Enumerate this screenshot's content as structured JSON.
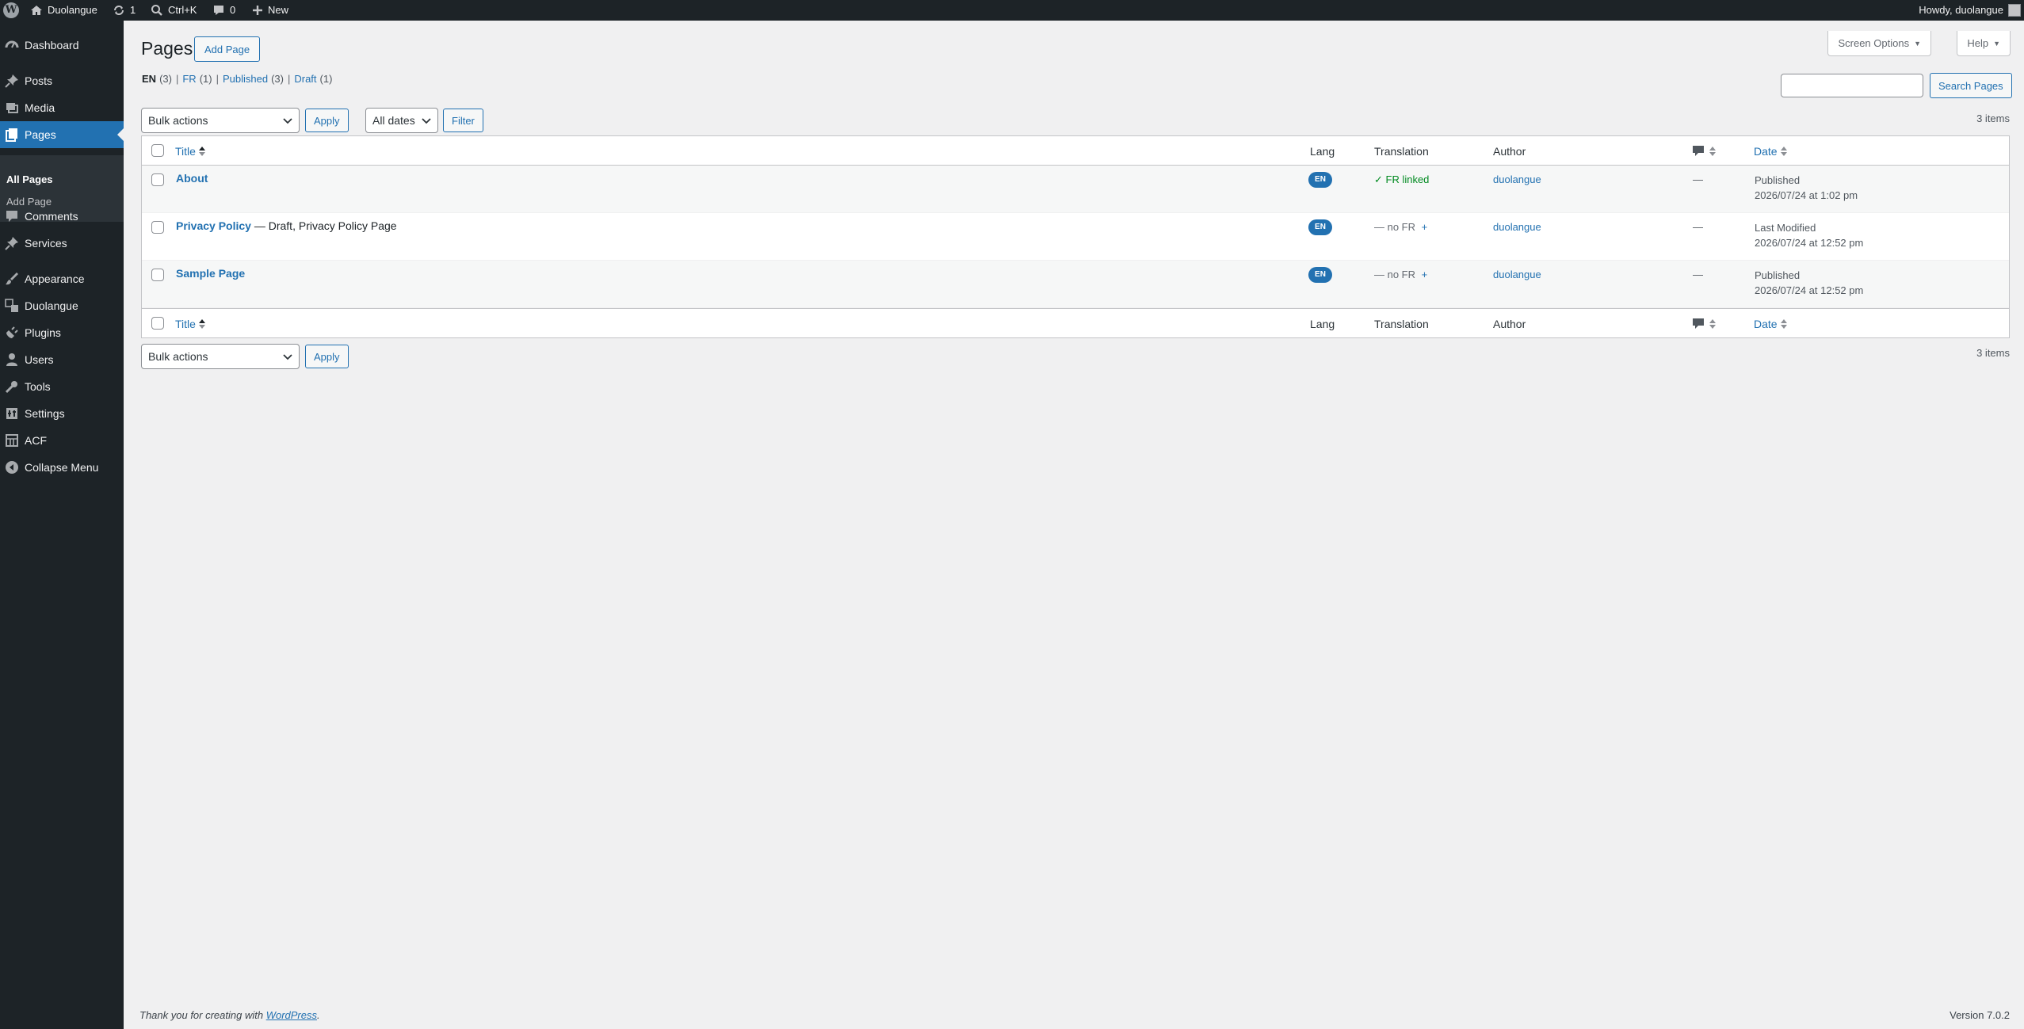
{
  "admin_bar": {
    "site_name": "Duolangue",
    "updates_count": "1",
    "search_shortcut": "Ctrl+K",
    "comments_count": "0",
    "new_label": "New",
    "howdy": "Howdy, duolangue"
  },
  "menu": {
    "items": [
      {
        "label": "Dashboard",
        "icon": "dashboard-icon"
      },
      {
        "label": "Posts",
        "icon": "pin-icon"
      },
      {
        "label": "Media",
        "icon": "media-icon"
      },
      {
        "label": "Pages",
        "icon": "pages-icon",
        "current": true
      },
      {
        "label": "Comments",
        "icon": "comment-icon"
      },
      {
        "label": "Services",
        "icon": "pin-icon"
      },
      {
        "label": "Appearance",
        "icon": "brush-icon"
      },
      {
        "label": "Duolangue",
        "icon": "translation-icon"
      },
      {
        "label": "Plugins",
        "icon": "plug-icon"
      },
      {
        "label": "Users",
        "icon": "user-icon"
      },
      {
        "label": "Tools",
        "icon": "wrench-icon"
      },
      {
        "label": "Settings",
        "icon": "settings-icon"
      },
      {
        "label": "ACF",
        "icon": "grid-icon"
      },
      {
        "label": "Collapse Menu",
        "icon": "collapse-icon"
      }
    ],
    "submenu": [
      "All Pages",
      "Add Page"
    ]
  },
  "header": {
    "screen_options": "Screen Options",
    "help": "Help",
    "title": "Pages",
    "add_page": "Add Page"
  },
  "views": [
    {
      "label": "EN",
      "count": "(3)",
      "current": true
    },
    {
      "label": "FR",
      "count": "(1)"
    },
    {
      "label": "Published",
      "count": "(3)"
    },
    {
      "label": "Draft",
      "count": "(1)"
    }
  ],
  "search": {
    "button": "Search Pages",
    "value": ""
  },
  "tablenav": {
    "bulk_actions": "Bulk actions",
    "apply": "Apply",
    "all_dates": "All dates",
    "filter": "Filter",
    "items_count": "3 items"
  },
  "table": {
    "columns": {
      "title": "Title",
      "lang": "Lang",
      "translation": "Translation",
      "author": "Author",
      "date": "Date"
    },
    "rows": [
      {
        "title": "About",
        "state": "",
        "lang": "EN",
        "translation": "✓ FR linked",
        "translation_linked": true,
        "author": "duolangue",
        "comments": "—",
        "date_status": "Published",
        "date": "2026/07/24 at 1:02 pm"
      },
      {
        "title": "Privacy Policy",
        "state": " — Draft, Privacy Policy Page",
        "lang": "EN",
        "translation": "— no FR",
        "translation_add": "+",
        "translation_linked": false,
        "author": "duolangue",
        "comments": "—",
        "date_status": "Last Modified",
        "date": "2026/07/24 at 12:52 pm"
      },
      {
        "title": "Sample Page",
        "state": "",
        "lang": "EN",
        "translation": "— no FR",
        "translation_add": "+",
        "translation_linked": false,
        "author": "duolangue",
        "comments": "—",
        "date_status": "Published",
        "date": "2026/07/24 at 12:52 pm"
      }
    ]
  },
  "footer": {
    "thanks_prefix": "Thank you for creating with ",
    "thanks_link": "WordPress",
    "thanks_suffix": ".",
    "version": "Version 7.0.2"
  },
  "colors": {
    "accent": "#2271b1",
    "adminbar": "#1d2327",
    "success": "#008a20"
  }
}
